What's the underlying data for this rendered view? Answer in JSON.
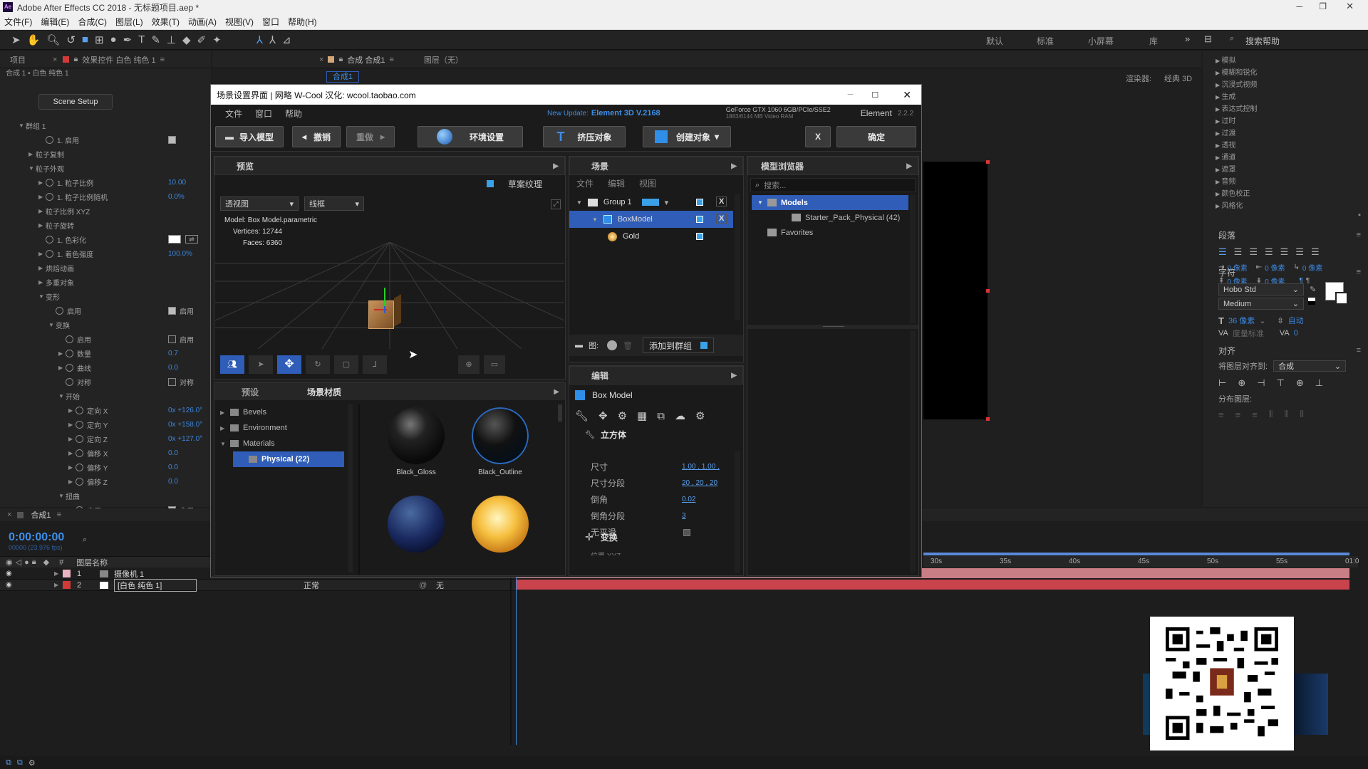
{
  "app": {
    "title": "Adobe After Effects CC 2018 - 无标题项目.aep *",
    "menus": [
      "文件(F)",
      "编辑(E)",
      "合成(C)",
      "图层(L)",
      "效果(T)",
      "动画(A)",
      "视图(V)",
      "窗口",
      "帮助(H)"
    ],
    "workspaces": [
      "默认",
      "标准",
      "小屏幕",
      "库"
    ],
    "search_placeholder": "搜索帮助"
  },
  "left_panel": {
    "tab_project": "项目",
    "tab_effects": "效果控件 白色 纯色 1",
    "breadcrumb": "合成 1 • 白色 纯色 1",
    "scene_setup": "Scene Setup",
    "props": [
      {
        "indent": 0,
        "arrow": "▼",
        "label": "群组 1",
        "value": "",
        "stop": false
      },
      {
        "indent": 2,
        "arrow": "",
        "label": "1. 启用",
        "value": "",
        "stop": true,
        "check": "on"
      },
      {
        "indent": 1,
        "arrow": "▶",
        "label": "粒子复制",
        "value": "",
        "stop": false
      },
      {
        "indent": 1,
        "arrow": "▼",
        "label": "粒子外观",
        "value": "",
        "stop": false
      },
      {
        "indent": 2,
        "arrow": "▶",
        "label": "1. 粒子比例",
        "value": "10.00",
        "stop": true
      },
      {
        "indent": 2,
        "arrow": "▶",
        "label": "1. 粒子比例随机",
        "value": "0.0%",
        "stop": true
      },
      {
        "indent": 2,
        "arrow": "▶",
        "label": "粒子比例 XYZ",
        "value": "",
        "stop": false
      },
      {
        "indent": 2,
        "arrow": "▶",
        "label": "粒子旋转",
        "value": "",
        "stop": false
      },
      {
        "indent": 2,
        "arrow": "",
        "label": "1. 色彩化",
        "value": "",
        "stop": true,
        "swatch": true
      },
      {
        "indent": 2,
        "arrow": "▶",
        "label": "1. 着色强度",
        "value": "100.0%",
        "stop": true
      },
      {
        "indent": 2,
        "arrow": "▶",
        "label": "烘焙动画",
        "value": "",
        "stop": false
      },
      {
        "indent": 2,
        "arrow": "▶",
        "label": "多重对象",
        "value": "",
        "stop": false
      },
      {
        "indent": 2,
        "arrow": "▼",
        "label": "变形",
        "value": "",
        "stop": false
      },
      {
        "indent": 3,
        "arrow": "",
        "label": "启用",
        "value": "",
        "stop": true,
        "check": "on",
        "check_label": "启用"
      },
      {
        "indent": 3,
        "arrow": "▼",
        "label": "变换",
        "value": "",
        "stop": false
      },
      {
        "indent": 4,
        "arrow": "",
        "label": "启用",
        "value": "",
        "stop": true,
        "check": "off",
        "check_label": "启用"
      },
      {
        "indent": 4,
        "arrow": "▶",
        "label": "数量",
        "value": "0.7",
        "stop": true
      },
      {
        "indent": 4,
        "arrow": "▶",
        "label": "曲线",
        "value": "0.0",
        "stop": true
      },
      {
        "indent": 4,
        "arrow": "",
        "label": "对称",
        "value": "",
        "stop": true,
        "check": "off",
        "check_label": "对称"
      },
      {
        "indent": 4,
        "arrow": "▼",
        "label": "开始",
        "value": "",
        "stop": false
      },
      {
        "indent": 5,
        "arrow": "▶",
        "label": "定向 X",
        "value": "0x +126.0°",
        "stop": true
      },
      {
        "indent": 5,
        "arrow": "▶",
        "label": "定向 Y",
        "value": "0x +158.0°",
        "stop": true
      },
      {
        "indent": 5,
        "arrow": "▶",
        "label": "定向 Z",
        "value": "0x +127.0°",
        "stop": true
      },
      {
        "indent": 5,
        "arrow": "▶",
        "label": "偏移 X",
        "value": "0.0",
        "stop": true
      },
      {
        "indent": 5,
        "arrow": "▶",
        "label": "偏移 Y",
        "value": "0.0",
        "stop": true
      },
      {
        "indent": 5,
        "arrow": "▶",
        "label": "偏移 Z",
        "value": "0.0",
        "stop": true
      },
      {
        "indent": 4,
        "arrow": "▼",
        "label": "扭曲",
        "value": "",
        "stop": false
      },
      {
        "indent": 5,
        "arrow": "",
        "label": "启用",
        "value": "",
        "stop": true,
        "check": "on",
        "check_label": "启用"
      }
    ]
  },
  "comp_panel": {
    "tab_comp": "合成 合成1",
    "tab_layer": "图层（无）",
    "comp_chip": "合成1",
    "renderer_label": "渲染器:",
    "renderer_value": "经典 3D"
  },
  "dialog": {
    "title": "场景设置界面 | 网略 W-Cool 汉化: wcool.taobao.com",
    "menu": [
      "文件",
      "窗口",
      "帮助"
    ],
    "update_prefix": "New Update:",
    "update_version": "Element 3D V.2168",
    "gpu_line1": "GeForce GTX 1060 6GB/PCIe/SSE2",
    "gpu_line2": "1883/6144 MB Video RAM",
    "element_label": "Element",
    "element_version": "2.2.2",
    "toolbar": {
      "import": "导入模型",
      "undo": "撤销",
      "redo": "重做",
      "environment": "环境设置",
      "extrude": "挤压对象",
      "create": "创建对象",
      "close_x": "X",
      "ok": "确定"
    },
    "preview": {
      "header": "预览",
      "draft_texture": "草案纹理",
      "view_select": "透视图",
      "shading_select": "线框",
      "model_label": "Model:",
      "model_value": "Box Model.parametric",
      "vertices_label": "Vertices:",
      "vertices_value": "12744",
      "faces_label": "Faces:",
      "faces_value": "6360"
    },
    "presets": {
      "tab1": "预设",
      "tab2": "场景材质",
      "tree": [
        {
          "label": "Bevels",
          "arrow": "▶",
          "indent": 0
        },
        {
          "label": "Environment",
          "arrow": "▶",
          "indent": 0
        },
        {
          "label": "Materials",
          "arrow": "▼",
          "indent": 0
        },
        {
          "label": "Physical (22)",
          "arrow": "",
          "indent": 1,
          "selected": true
        }
      ],
      "materials": [
        "Black_Gloss",
        "Black_Outline",
        "",
        ""
      ]
    },
    "scene": {
      "header": "场景",
      "menu": [
        "文件",
        "编辑",
        "视图"
      ],
      "items": [
        {
          "label": "Group 1",
          "indent": 0,
          "x": "X",
          "selected": false
        },
        {
          "label": "BoxModel",
          "indent": 1,
          "x": "X",
          "selected": true
        },
        {
          "label": "Gold",
          "indent": 2,
          "x": "",
          "selected": false
        }
      ],
      "add_group": "添加到群组",
      "fig_label": "图:"
    },
    "edit": {
      "header": "编辑",
      "object": "Box Model",
      "section": "立方体",
      "props": [
        {
          "label": "尺寸",
          "value": "1.00 , 1.00 ,"
        },
        {
          "label": "尺寸分段",
          "value": "20 , 20 , 20"
        },
        {
          "label": "倒角",
          "value": "0.02"
        },
        {
          "label": "倒角分段",
          "value": "3"
        },
        {
          "label": "无平滑",
          "value": ""
        }
      ],
      "transform": "变换",
      "cut_row": "位置  XYZ"
    },
    "browser": {
      "header": "模型浏览器",
      "search_placeholder": "搜索...",
      "tree": [
        {
          "label": "Models",
          "indent": 0,
          "arrow": "▼",
          "selected": true
        },
        {
          "label": "Starter_Pack_Physical (42)",
          "indent": 1,
          "arrow": "",
          "selected": false
        },
        {
          "label": "Favorites",
          "indent": 0,
          "arrow": "",
          "selected": false
        }
      ]
    }
  },
  "right_panel": {
    "effects": [
      "模拟",
      "模糊和锐化",
      "沉浸式视频",
      "生成",
      "表达式控制",
      "过时",
      "过渡",
      "透视",
      "通道",
      "遮罩",
      "音频",
      "颜色校正",
      "风格化"
    ],
    "paragraph_title": "段落",
    "para_values": [
      "0 像素",
      "0 像素",
      "0 像素",
      "0 像素",
      "0 像素"
    ],
    "char_title": "字符",
    "font": "Hobo Std",
    "style": "Medium",
    "size": "36 像素",
    "leading": "自动",
    "tracking_label": "度量标准",
    "tracking_value": "0",
    "align_title": "对齐",
    "align_to_label": "将图层对齐到:",
    "align_to_value": "合成",
    "distribute_label": "分布图层:"
  },
  "timeline": {
    "tab": "合成1",
    "timecode": "0:00:00:00",
    "frames": "00000 (23.976 fps)",
    "col_name": "图层名称",
    "col_hash": "#",
    "layers": [
      {
        "num": "1",
        "name": "摄像机 1",
        "color": "#e8b4c4",
        "mode": "",
        "track": "无"
      },
      {
        "num": "2",
        "name": "[白色 纯色 1]",
        "color": "#d23a3a",
        "mode": "正常",
        "track": "无"
      }
    ],
    "ruler": [
      "30s",
      "35s",
      "40s",
      "45s",
      "50s",
      "55s",
      "01:0"
    ]
  },
  "colors": {
    "accent": "#3d8ee8",
    "selected": "#2f5db7",
    "layer_bar": "#c97d85"
  }
}
